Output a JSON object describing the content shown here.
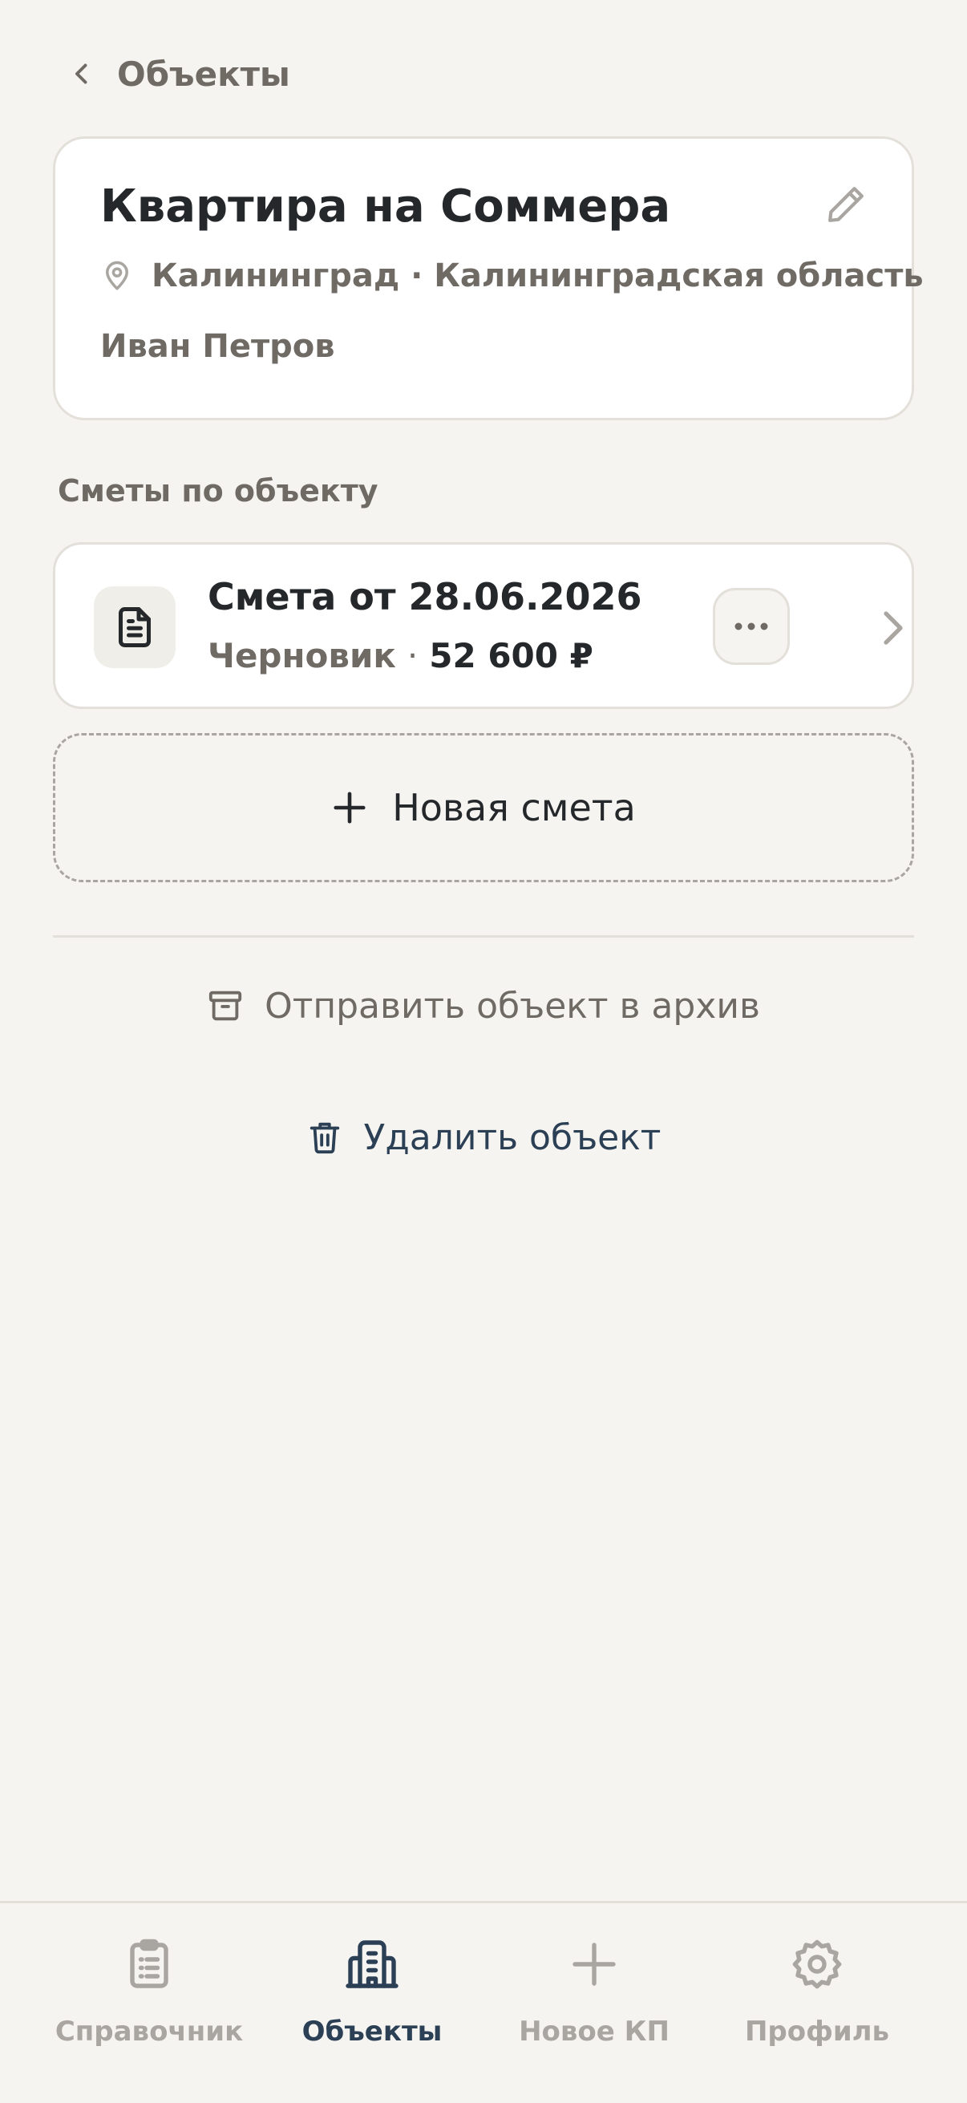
{
  "header": {
    "back_label": "Объекты"
  },
  "object": {
    "title": "Квартира на Соммера",
    "location": "Калининград · Калининградская область",
    "owner": "Иван Петров"
  },
  "estimates_section": {
    "label": "Сметы по объекту",
    "items": [
      {
        "title": "Смета от 28.06.2026",
        "status": "Черновик",
        "separator": "·",
        "amount": "52 600 ₽"
      }
    ],
    "new_label": "Новая смета"
  },
  "actions": {
    "archive_label": "Отправить объект в архив",
    "delete_label": "Удалить объект"
  },
  "bottom_nav": {
    "items": [
      {
        "label": "Справочник",
        "icon": "clipboard-list-icon",
        "active": false
      },
      {
        "label": "Объекты",
        "icon": "building-icon",
        "active": true
      },
      {
        "label": "Новое КП",
        "icon": "plus-icon",
        "active": false
      },
      {
        "label": "Профиль",
        "icon": "gear-icon",
        "active": false
      }
    ]
  },
  "colors": {
    "background": "#f5f4f1",
    "card": "#ffffff",
    "text_primary": "#25282b",
    "text_secondary": "#6f6b64",
    "accent_navy": "#2b3f55",
    "inactive": "#a9a5a0",
    "border": "#e3e0da"
  }
}
